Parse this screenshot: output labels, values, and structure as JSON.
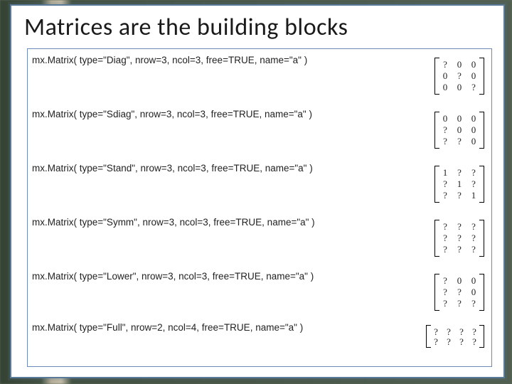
{
  "title": "Matrices are the building blocks",
  "rows": [
    {
      "code": "mx.Matrix( type=\"Diag\", nrow=3, ncol=3, free=TRUE, name=\"a\" )",
      "matrix": {
        "cols": 3,
        "cells": [
          "?",
          "0",
          "0",
          "0",
          "?",
          "0",
          "0",
          "0",
          "?"
        ]
      }
    },
    {
      "code": "mx.Matrix( type=\"Sdiag\", nrow=3, ncol=3, free=TRUE, name=\"a\" )",
      "matrix": {
        "cols": 3,
        "cells": [
          "0",
          "0",
          "0",
          "?",
          "0",
          "0",
          "?",
          "?",
          "0"
        ]
      }
    },
    {
      "code": "mx.Matrix( type=\"Stand\", nrow=3, ncol=3, free=TRUE, name=\"a\" )",
      "matrix": {
        "cols": 3,
        "cells": [
          "1",
          "?",
          "?",
          "?",
          "1",
          "?",
          "?",
          "?",
          "1"
        ]
      }
    },
    {
      "code": "mx.Matrix( type=\"Symm\", nrow=3, ncol=3, free=TRUE, name=\"a\" )",
      "matrix": {
        "cols": 3,
        "cells": [
          "?",
          "?",
          "?",
          "?",
          "?",
          "?",
          "?",
          "?",
          "?"
        ]
      }
    },
    {
      "code": "mx.Matrix( type=\"Lower\", nrow=3, ncol=3, free=TRUE, name=\"a\" )",
      "matrix": {
        "cols": 3,
        "cells": [
          "?",
          "0",
          "0",
          "?",
          "?",
          "0",
          "?",
          "?",
          "?"
        ]
      }
    },
    {
      "code": "mx.Matrix( type=\"Full\", nrow=2, ncol=4, free=TRUE, name=\"a\" )",
      "matrix": {
        "cols": 4,
        "cells": [
          "?",
          "?",
          "?",
          "?",
          "?",
          "?",
          "?",
          "?"
        ]
      }
    }
  ]
}
